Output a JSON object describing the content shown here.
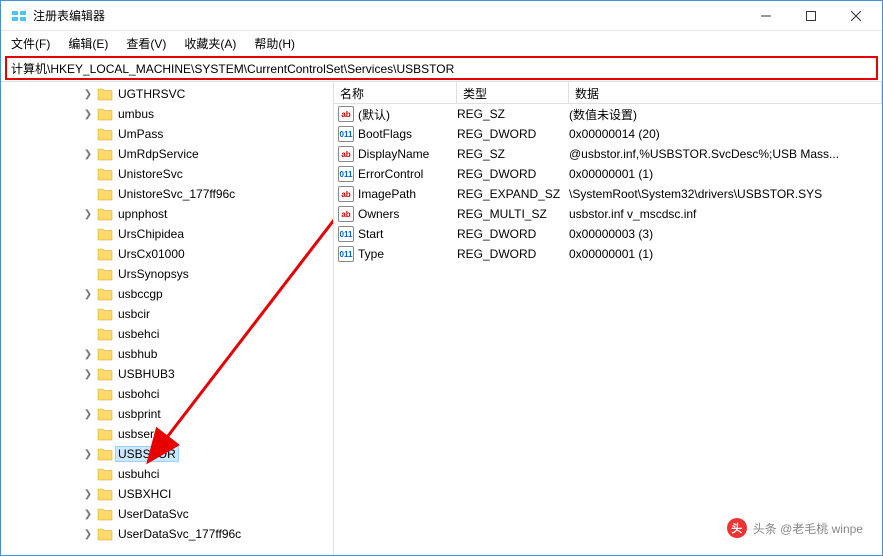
{
  "window": {
    "title": "注册表编辑器"
  },
  "menu": {
    "file": "文件(F)",
    "edit": "编辑(E)",
    "view": "查看(V)",
    "favorites": "收藏夹(A)",
    "help": "帮助(H)"
  },
  "address": "计算机\\HKEY_LOCAL_MACHINE\\SYSTEM\\CurrentControlSet\\Services\\USBSTOR",
  "columns": {
    "name": "名称",
    "type": "类型",
    "data": "数据"
  },
  "tree": [
    {
      "label": "UGTHRSVC",
      "expandable": true
    },
    {
      "label": "umbus",
      "expandable": true
    },
    {
      "label": "UmPass",
      "expandable": false
    },
    {
      "label": "UmRdpService",
      "expandable": true
    },
    {
      "label": "UnistoreSvc",
      "expandable": false
    },
    {
      "label": "UnistoreSvc_177ff96c",
      "expandable": false
    },
    {
      "label": "upnphost",
      "expandable": true
    },
    {
      "label": "UrsChipidea",
      "expandable": false
    },
    {
      "label": "UrsCx01000",
      "expandable": false
    },
    {
      "label": "UrsSynopsys",
      "expandable": false
    },
    {
      "label": "usbccgp",
      "expandable": true
    },
    {
      "label": "usbcir",
      "expandable": false
    },
    {
      "label": "usbehci",
      "expandable": false
    },
    {
      "label": "usbhub",
      "expandable": true
    },
    {
      "label": "USBHUB3",
      "expandable": true
    },
    {
      "label": "usbohci",
      "expandable": false
    },
    {
      "label": "usbprint",
      "expandable": true
    },
    {
      "label": "usbser",
      "expandable": false
    },
    {
      "label": "USBSTOR",
      "expandable": true,
      "selected": true
    },
    {
      "label": "usbuhci",
      "expandable": false
    },
    {
      "label": "USBXHCI",
      "expandable": true
    },
    {
      "label": "UserDataSvc",
      "expandable": true
    },
    {
      "label": "UserDataSvc_177ff96c",
      "expandable": true
    }
  ],
  "values": [
    {
      "icon": "str",
      "iconText": "ab",
      "name": "(默认)",
      "type": "REG_SZ",
      "data": "(数值未设置)"
    },
    {
      "icon": "bin",
      "iconText": "011",
      "name": "BootFlags",
      "type": "REG_DWORD",
      "data": "0x00000014 (20)"
    },
    {
      "icon": "str",
      "iconText": "ab",
      "name": "DisplayName",
      "type": "REG_SZ",
      "data": "@usbstor.inf,%USBSTOR.SvcDesc%;USB Mass..."
    },
    {
      "icon": "bin",
      "iconText": "011",
      "name": "ErrorControl",
      "type": "REG_DWORD",
      "data": "0x00000001 (1)"
    },
    {
      "icon": "str",
      "iconText": "ab",
      "name": "ImagePath",
      "type": "REG_EXPAND_SZ",
      "data": "\\SystemRoot\\System32\\drivers\\USBSTOR.SYS"
    },
    {
      "icon": "str",
      "iconText": "ab",
      "name": "Owners",
      "type": "REG_MULTI_SZ",
      "data": "usbstor.inf v_mscdsc.inf"
    },
    {
      "icon": "bin",
      "iconText": "011",
      "name": "Start",
      "type": "REG_DWORD",
      "data": "0x00000003 (3)"
    },
    {
      "icon": "bin",
      "iconText": "011",
      "name": "Type",
      "type": "REG_DWORD",
      "data": "0x00000001 (1)"
    }
  ],
  "watermark": "头条 @老毛桃 winpe"
}
